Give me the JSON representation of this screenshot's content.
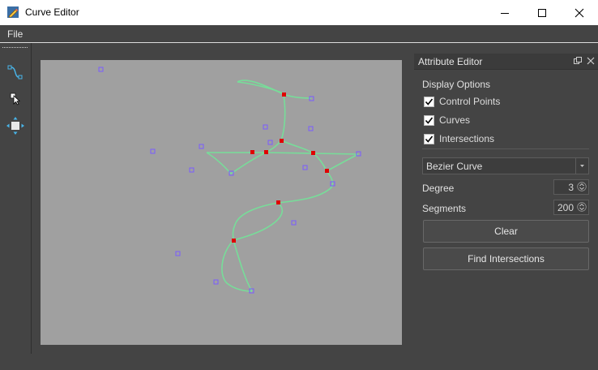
{
  "window": {
    "title": "Curve Editor"
  },
  "menu": {
    "file": "File"
  },
  "attribute_editor": {
    "title": "Attribute Editor",
    "display_options_title": "Display Options",
    "checkboxes": [
      {
        "label": "Control Points",
        "checked": true
      },
      {
        "label": "Curves",
        "checked": true
      },
      {
        "label": "Intersections",
        "checked": true
      }
    ],
    "curve_type": "Bezier Curve",
    "degree_label": "Degree",
    "degree_value": "3",
    "segments_label": "Segments",
    "segments_value": "200",
    "clear_button": "Clear",
    "find_intersections_button": "Find Intersections"
  },
  "colors": {
    "curve": "#77dd99",
    "control_point": "#7a5cff",
    "intersection": "#e00000",
    "canvas": "#a0a0a0",
    "panel": "#444444"
  },
  "icons": [
    "app-pencil-icon",
    "curve-tool-icon",
    "select-pointer-icon",
    "move-tool-icon",
    "minimize-icon",
    "maximize-icon",
    "close-icon",
    "float-panel-icon",
    "close-panel-icon",
    "dropdown-arrow-icon",
    "spin-arrows-icon",
    "checkmark-icon"
  ]
}
